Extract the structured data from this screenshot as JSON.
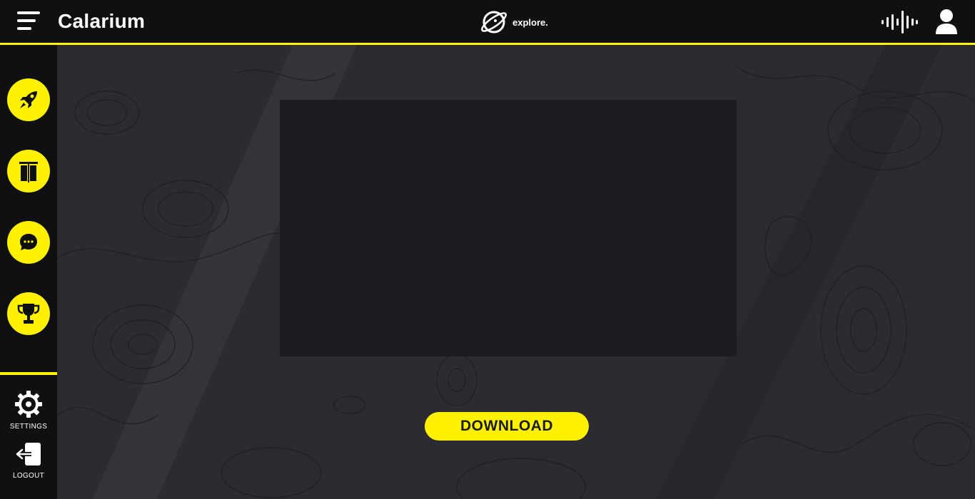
{
  "app": {
    "title": "Calarium"
  },
  "brand": {
    "word": "explore."
  },
  "sidebar": {
    "items": [
      {
        "icon": "rocket-icon"
      },
      {
        "icon": "columns-icon"
      },
      {
        "icon": "chat-icon"
      },
      {
        "icon": "trophy-icon"
      }
    ],
    "settings_label": "SETTINGS",
    "logout_label": "LOGOUT"
  },
  "main": {
    "download_label": "DOWNLOAD"
  },
  "colors": {
    "accent": "#fff200",
    "bar": "#0f1012",
    "background": "#2b2b31",
    "frame": "#1b1c20"
  }
}
